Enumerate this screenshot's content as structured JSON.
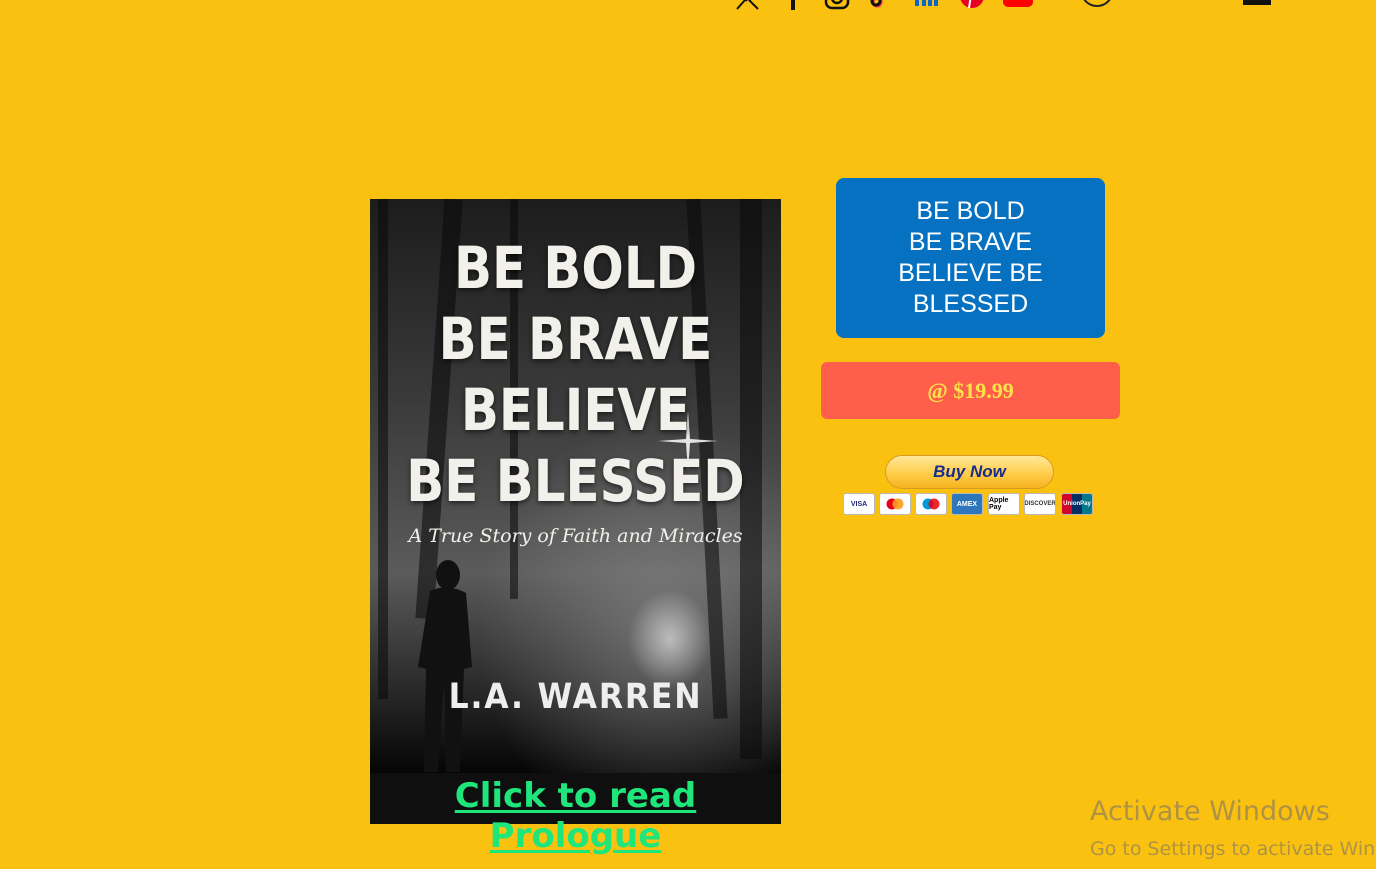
{
  "header": {
    "social_icons": [
      "x-icon",
      "facebook-icon",
      "instagram-icon",
      "tiktok-icon",
      "linkedin-icon",
      "pinterest-icon",
      "youtube-icon"
    ],
    "login_icon": "user-account-icon",
    "cart_icon": "shopping-cart-icon"
  },
  "book": {
    "cover_title_lines": [
      "BE BOLD",
      "BE BRAVE",
      "BELIEVE",
      "BE BLESSED"
    ],
    "cover_subtitle": "A True Story of Faith and Miracles",
    "cover_author": "L.A. WARREN",
    "prologue_link": "Click to read Prologue"
  },
  "product": {
    "title_lines": [
      "BE BOLD",
      "BE BRAVE",
      "BELIEVE BE",
      "BLESSED"
    ],
    "price_label": "@ $19.99",
    "buy_button": "Buy Now",
    "payment_cards": [
      "VISA",
      "mastercard",
      "maestro",
      "AMEX",
      "Apple Pay",
      "DISCOVER",
      "UnionPay"
    ]
  },
  "overlay": {
    "activate_title": "Activate Windows",
    "activate_subtitle": "Go to Settings to activate Windows."
  },
  "colors": {
    "background": "#FBC111",
    "blue_box": "#0571C0",
    "price_button": "#FF5F4A",
    "price_text": "#FBE34A",
    "prologue_link": "#1EE67A"
  }
}
